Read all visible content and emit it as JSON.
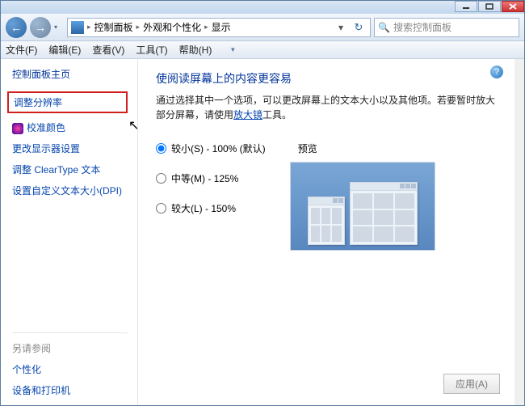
{
  "titlebar": {
    "min": "–",
    "max": "▢",
    "close": "✕"
  },
  "nav": {
    "back": "←",
    "fwd": "→",
    "crumbs": [
      "控制面板",
      "外观和个性化",
      "显示"
    ],
    "refresh": "↻"
  },
  "search": {
    "placeholder": "搜索控制面板",
    "icon": "🔍"
  },
  "menu": {
    "file": "文件(F)",
    "edit": "编辑(E)",
    "view": "查看(V)",
    "tools": "工具(T)",
    "help": "帮助(H)"
  },
  "sidebar": {
    "head": "控制面板主页",
    "items": [
      {
        "label": "调整分辨率",
        "highlighted": true
      },
      {
        "label": "校准颜色",
        "icon": true
      },
      {
        "label": "更改显示器设置"
      },
      {
        "label": "调整 ClearType 文本"
      },
      {
        "label": "设置自定义文本大小(DPI)"
      }
    ],
    "also_head": "另请参阅",
    "also": [
      "个性化",
      "设备和打印机"
    ]
  },
  "main": {
    "title": "使阅读屏幕上的内容更容易",
    "desc1": "通过选择其中一个选项，可以更改屏幕上的文本大小以及其他项。若要暂时放大部分屏幕，请使用",
    "desc_link": "放大镜",
    "desc2": "工具。",
    "options": [
      {
        "label": "较小(S) - 100% (默认)",
        "checked": true
      },
      {
        "label": "中等(M) - 125%",
        "checked": false
      },
      {
        "label": "较大(L) - 150%",
        "checked": false
      }
    ],
    "preview_label": "预览",
    "apply": "应用(A)"
  },
  "help": "?"
}
